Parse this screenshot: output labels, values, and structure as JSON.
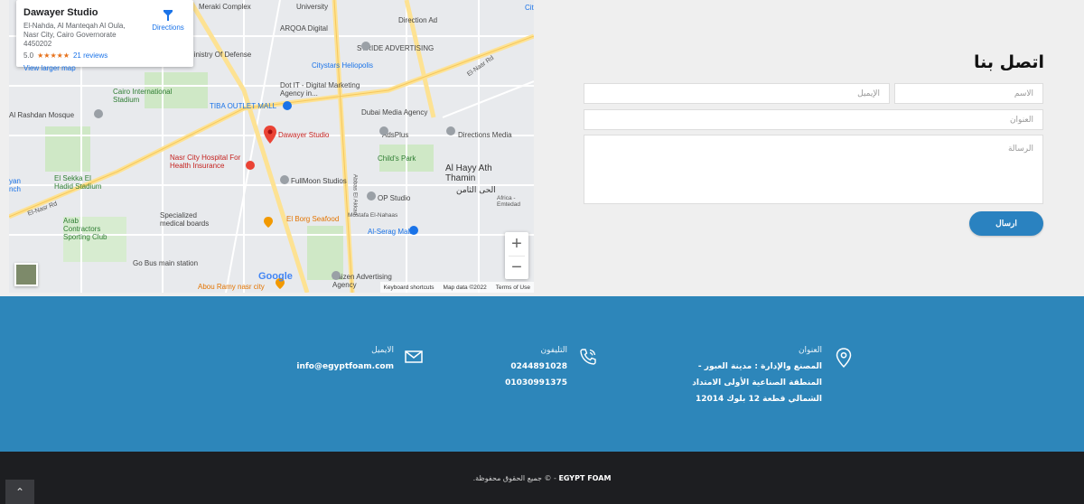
{
  "map": {
    "place_name": "Dawayer Studio",
    "place_address": "El-Nahda, Al Manteqah Al Oula, Nasr City, Cairo Governorate 4450202",
    "rating": "5.0",
    "stars": "★★★★★",
    "reviews": "21 reviews",
    "directions": "Directions",
    "view_larger": "View larger map",
    "google": "Google",
    "attribution": {
      "shortcuts": "Keyboard shortcuts",
      "map_data": "Map data ©2022",
      "terms": "Terms of Use"
    },
    "zoom_in": "+",
    "zoom_out": "−",
    "labels": {
      "meraki": "Meraki Complex",
      "university": "University",
      "arqoa": "ARQOA Digital",
      "direction_ad": "Direction Ad",
      "city": "City",
      "stride": "STRIDE ADVERTISING",
      "ministry": "Ministry Of Defense",
      "citystars": "Citystars Heliopolis",
      "cairo_stadium": "Cairo International Stadium",
      "dotit": "Dot IT - Digital Marketing Agency in...",
      "tiba": "TIBA OUTLET MALL",
      "dubai": "Dubai Media Agency",
      "rashdan": "Al Rashdan Mosque",
      "dawayer": "Dawayer Studio",
      "adsplus": "AdsPlus",
      "directions_media": "Directions Media",
      "nasr_hospital": "Nasr City Hospital For Health Insurance",
      "childs_park": "Child's Park",
      "al_hayy": "Al Hayy Ath Thamin",
      "al_hayy_ar": "الحى الثامن",
      "sekka": "El Sekka El Hadid Stadium",
      "fullmoon": "FullMoon Studios",
      "op_studio": "OP Studio",
      "elnasr_rd": "El-Nasr Rd",
      "specialized": "Specialized medical boards",
      "borg": "El Borg Seafood",
      "arab": "Arab Contractors Sporting Club",
      "serag": "Al-Serag Mall",
      "gobus": "Go Bus main station",
      "kaizen": "Kaizen Advertising Agency",
      "abou_ramy": "Abou Ramy nasr city",
      "mostafa": "Mostafa El-Nahaas",
      "abbas": "Abbas El Akkad",
      "africa": "Africa - Emtedad",
      "yan": "yan nch"
    }
  },
  "contact": {
    "title": "اتصل بنا",
    "name_placeholder": "الاسم",
    "email_placeholder": "الإيميل",
    "address_placeholder": "العنوان",
    "message_placeholder": "الرسالة",
    "send": "ارسال"
  },
  "info": {
    "address_label": "العنوان",
    "address_value": "المصنع والإدارة : مدينة العبور - المنطقة الصناعية الأولى الامتداد الشمالي قطعة 12 بلوك 12014",
    "phone_label": "التليفون",
    "phone_1": "0244891028",
    "phone_2": "01030991375",
    "email_label": "الايميل",
    "email_value": "info@egyptfoam.com"
  },
  "footer": {
    "brand": "EGYPT FOAM",
    "copyright": "- © جميع الحقوق محفوظة.",
    "to_top": "⌃"
  },
  "colors": {
    "accent": "#2a82c0",
    "band": "#2d86ba",
    "footer": "#1d1e21"
  }
}
